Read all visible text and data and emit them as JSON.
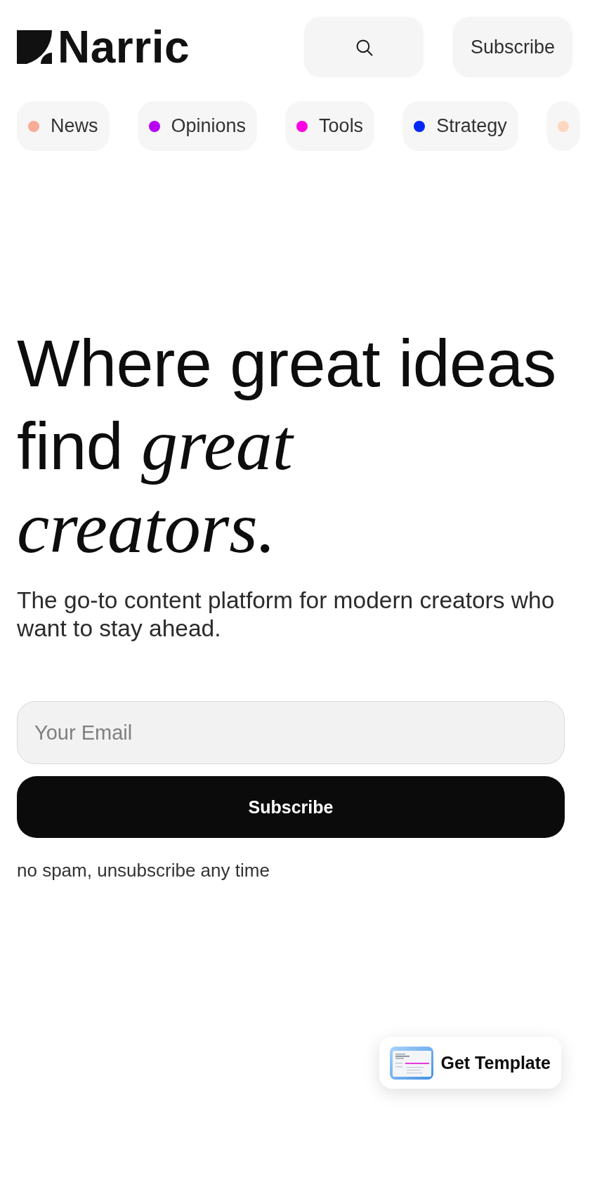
{
  "header": {
    "logo": "Narric",
    "subscribe_button": "Subscribe"
  },
  "categories": [
    {
      "label": "News",
      "color": "#f8ad99"
    },
    {
      "label": "Opinions",
      "color": "#b600f5"
    },
    {
      "label": "Tools",
      "color": "#ff00e4"
    },
    {
      "label": "Strategy",
      "color": "#0028f4"
    },
    {
      "color": "#fdd7c0"
    }
  ],
  "hero": {
    "headline": "Where great ideas find *great creators.*",
    "subtitle": "The go-to content platform for modern creators who want to stay ahead.",
    "email_field": {
      "placeholder": "Your Email"
    },
    "submit_button": "Subscribe",
    "note": "no spam, unsubscribe any time"
  },
  "template_button": "Get Template"
}
